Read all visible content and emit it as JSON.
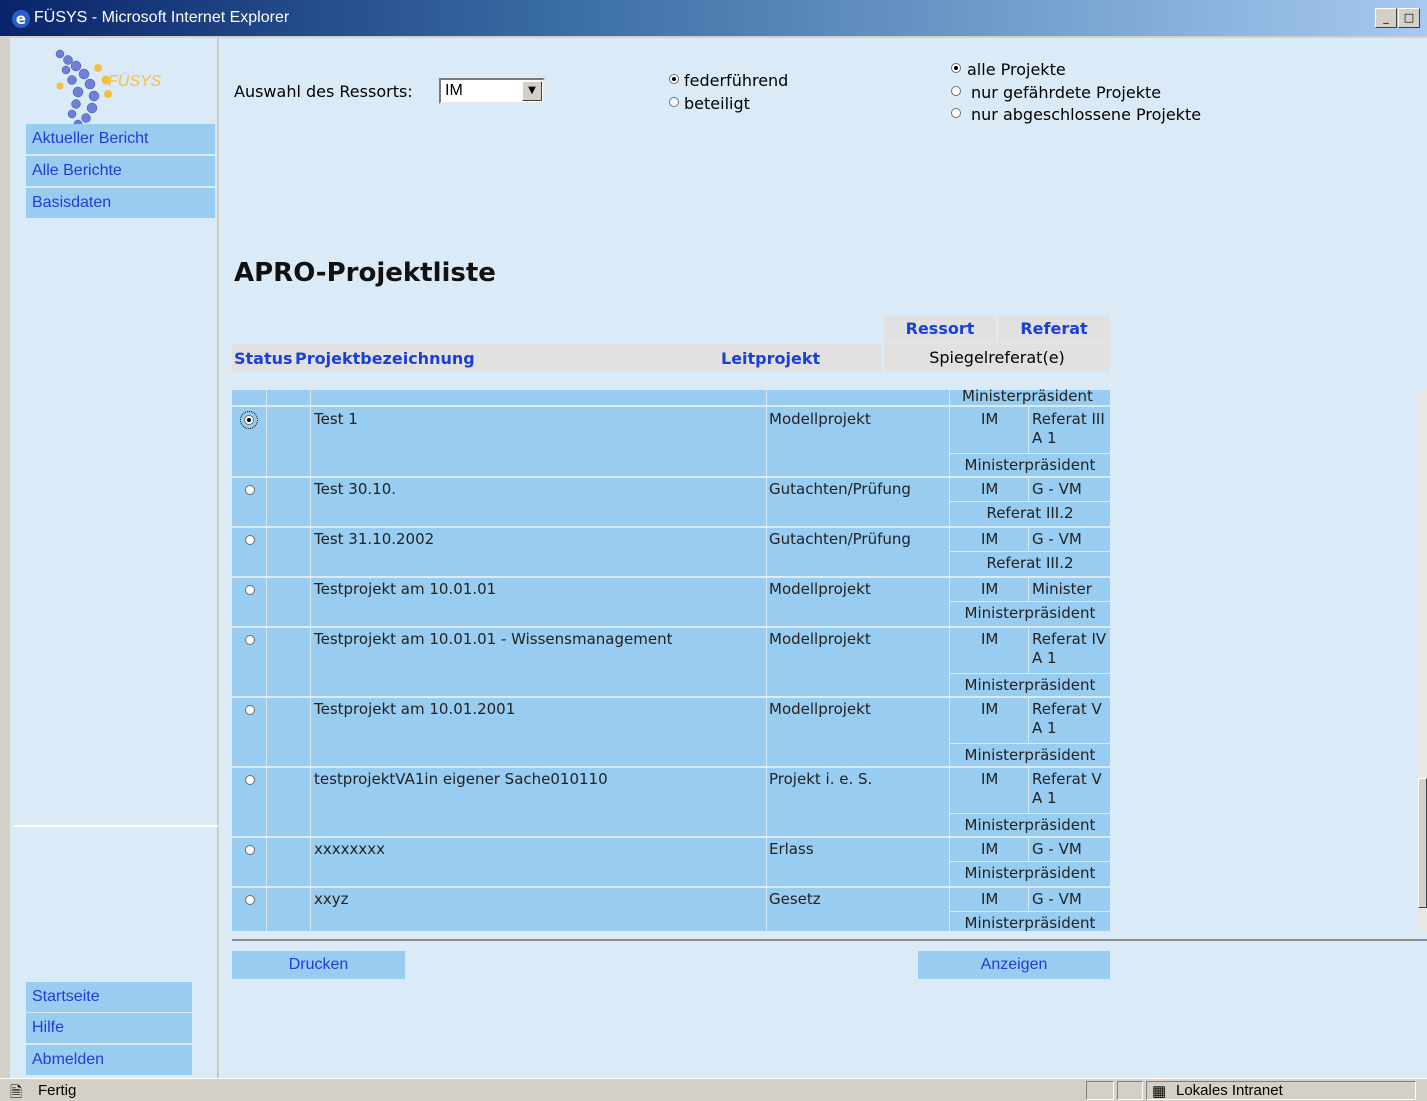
{
  "window": {
    "title": "FÜSYS - Microsoft Internet Explorer",
    "minimize_glyph": "_",
    "maximize_glyph": "□"
  },
  "sidebar": {
    "logo_text": "FÜSYS",
    "top_items": [
      "Aktueller Bericht",
      "Alle Berichte",
      "Basisdaten"
    ],
    "bottom_items": [
      "Startseite",
      "Hilfe",
      "Abmelden"
    ]
  },
  "filters": {
    "ressort_label": "Auswahl des Ressorts:",
    "ressort_value": "IM",
    "role_options": [
      {
        "label": "federführend",
        "selected": true
      },
      {
        "label": "beteiligt",
        "selected": false
      }
    ],
    "project_options": [
      {
        "label": "alle Projekte",
        "selected": true
      },
      {
        "label": "nur gefährdete Projekte",
        "selected": false
      },
      {
        "label": "nur abgeschlossene Projekte",
        "selected": false
      }
    ]
  },
  "page": {
    "heading": "APRO-Projektliste"
  },
  "table": {
    "headers": {
      "status": "Status",
      "name": "Projektbezeichnung",
      "lead": "Leitprojekt",
      "ressort": "Ressort",
      "referat": "Referat",
      "mirror": "Spiegelreferat(e)"
    },
    "partial_top": "Ministerpräsident",
    "rows": [
      {
        "name": "Test 1",
        "lead": "Modellprojekt",
        "ressort": "IM",
        "referat": "Referat III A 1",
        "mirror": "Ministerpräsident",
        "selected": true
      },
      {
        "name": "Test 30.10.",
        "lead": "Gutachten/Prüfung",
        "ressort": "IM",
        "referat": "G - VM",
        "mirror": "Referat III.2",
        "selected": false
      },
      {
        "name": "Test 31.10.2002",
        "lead": "Gutachten/Prüfung",
        "ressort": "IM",
        "referat": "G - VM",
        "mirror": "Referat III.2",
        "selected": false
      },
      {
        "name": "Testprojekt am 10.01.01",
        "lead": "Modellprojekt",
        "ressort": "IM",
        "referat": "Minister",
        "mirror": "Ministerpräsident",
        "selected": false
      },
      {
        "name": "Testprojekt am 10.01.01 - Wissensmanagement",
        "lead": "Modellprojekt",
        "ressort": "IM",
        "referat": "Referat IV A 1",
        "mirror": "Ministerpräsident",
        "selected": false
      },
      {
        "name": "Testprojekt am 10.01.2001",
        "lead": "Modellprojekt",
        "ressort": "IM",
        "referat": "Referat V A 1",
        "mirror": "Ministerpräsident",
        "selected": false
      },
      {
        "name": "testprojektVA1in eigener Sache010110",
        "lead": "Projekt i. e. S.",
        "ressort": "IM",
        "referat": "Referat V A 1",
        "mirror": "Ministerpräsident",
        "selected": false
      },
      {
        "name": "xxxxxxxx",
        "lead": "Erlass",
        "ressort": "IM",
        "referat": "G - VM",
        "mirror": "Ministerpräsident",
        "selected": false
      },
      {
        "name": "xxyz",
        "lead": "Gesetz",
        "ressort": "IM",
        "referat": "G - VM",
        "mirror": "Ministerpräsident",
        "selected": false
      }
    ]
  },
  "actions": {
    "print": "Drucken",
    "show": "Anzeigen"
  },
  "statusbar": {
    "status": "Fertig",
    "zone": "Lokales Intranet"
  }
}
